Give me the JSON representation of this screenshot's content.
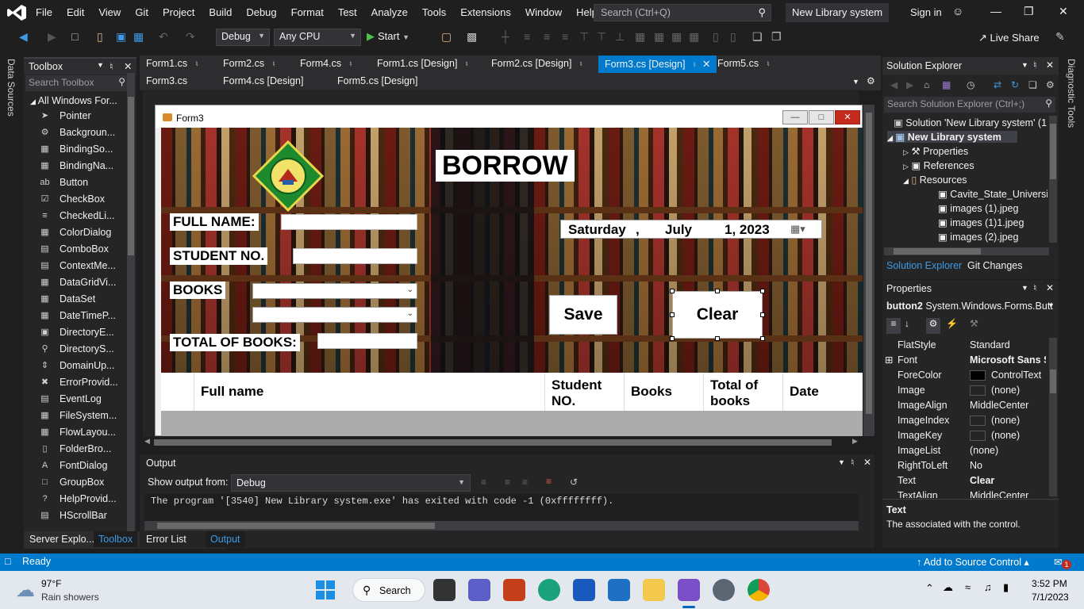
{
  "menu": {
    "items": [
      "File",
      "Edit",
      "View",
      "Git",
      "Project",
      "Build",
      "Debug",
      "Format",
      "Test",
      "Analyze",
      "Tools",
      "Extensions",
      "Window",
      "Help"
    ],
    "search_placeholder": "Search (Ctrl+Q)",
    "solution_name": "New Library system",
    "sign_in": "Sign in"
  },
  "toolbar": {
    "config": "Debug",
    "platform": "Any CPU",
    "start": "Start",
    "live_share": "Live Share"
  },
  "left_strip": {
    "label": "Data Sources"
  },
  "right_strip": {
    "label": "Diagnostic Tools"
  },
  "toolbox": {
    "title": "Toolbox",
    "search_placeholder": "Search Toolbox",
    "group": "All Windows For...",
    "items": [
      "Pointer",
      "Backgroun...",
      "BindingSo...",
      "BindingNa...",
      "Button",
      "CheckBox",
      "CheckedLi...",
      "ColorDialog",
      "ComboBox",
      "ContextMe...",
      "DataGridVi...",
      "DataSet",
      "DateTimeP...",
      "DirectoryE...",
      "DirectoryS...",
      "DomainUp...",
      "ErrorProvid...",
      "EventLog",
      "FileSystem...",
      "FlowLayou...",
      "FolderBro...",
      "FontDialog",
      "GroupBox",
      "HelpProvid...",
      "HScrollBar"
    ],
    "bottom_tabs": [
      "Server Explo...",
      "Toolbox"
    ]
  },
  "doc_tabs": {
    "row1": [
      "Form1.cs",
      "Form2.cs",
      "Form4.cs",
      "Form1.cs [Design]",
      "Form2.cs [Design]",
      "Form3.cs [Design]",
      "Form5.cs"
    ],
    "row2": [
      "Form3.cs",
      "Form4.cs [Design]",
      "Form5.cs [Design]"
    ],
    "active": "Form3.cs [Design]"
  },
  "form": {
    "title": "Form3",
    "heading": "BORROW",
    "full_name_label": "FULL NAME:",
    "student_no_label": "STUDENT NO.",
    "books_label": "BOOKS",
    "total_books_label": "TOTAL OF BOOKS:",
    "date": {
      "day": "Saturday",
      "sep": ",",
      "month": "July",
      "day_num": "1, 2023"
    },
    "save_button": "Save",
    "clear_button": "Clear",
    "grid_columns": [
      "Full name",
      "Student NO.",
      "Books",
      "Total of books",
      "Date"
    ]
  },
  "output": {
    "title": "Output",
    "show_from_label": "Show output from:",
    "source": "Debug",
    "text": "The program '[3540] New Library system.exe' has exited with code -1 (0xffffffff).",
    "bottom_tabs": [
      "Error List",
      "Output"
    ]
  },
  "solution_explorer": {
    "title": "Solution Explorer",
    "search_placeholder": "Search Solution Explorer (Ctrl+;)",
    "nodes": [
      "Solution 'New Library system' (1",
      "New Library system",
      "Properties",
      "References",
      "Resources",
      "Cavite_State_Universit",
      "images (1).jpeg",
      "images (1)1.jpeg",
      "images (2).jpeg"
    ],
    "tabs": [
      "Solution Explorer",
      "Git Changes"
    ]
  },
  "properties": {
    "title": "Properties",
    "object": "button2",
    "object_type": "System.Windows.Forms.Butt",
    "rows": [
      {
        "name": "FlatStyle",
        "value": "Standard"
      },
      {
        "name": "Font",
        "value": "Microsoft Sans S"
      },
      {
        "name": "ForeColor",
        "value": "ControlText",
        "swatch": "#000000"
      },
      {
        "name": "Image",
        "value": "(none)",
        "swatch": "#1e1e1e"
      },
      {
        "name": "ImageAlign",
        "value": "MiddleCenter"
      },
      {
        "name": "ImageIndex",
        "value": "(none)",
        "swatch": "#1e1e1e"
      },
      {
        "name": "ImageKey",
        "value": "(none)",
        "swatch": "#1e1e1e"
      },
      {
        "name": "ImageList",
        "value": "(none)"
      },
      {
        "name": "RightToLeft",
        "value": "No"
      },
      {
        "name": "Text",
        "value": "Clear"
      },
      {
        "name": "TextAlign",
        "value": "MiddleCenter"
      }
    ],
    "desc_title": "Text",
    "desc_text": "The associated with the control."
  },
  "status": {
    "ready": "Ready",
    "source_control": "Add to Source Control",
    "notifications": "1"
  },
  "taskbar": {
    "weather_temp": "97°F",
    "weather_desc": "Rain showers",
    "search": "Search",
    "time": "3:52 PM",
    "date": "7/1/2023"
  },
  "colors": {
    "accent": "#007acc",
    "ide_bg": "#1e1e1e",
    "panel": "#252526",
    "close_red": "#c42b1c"
  }
}
